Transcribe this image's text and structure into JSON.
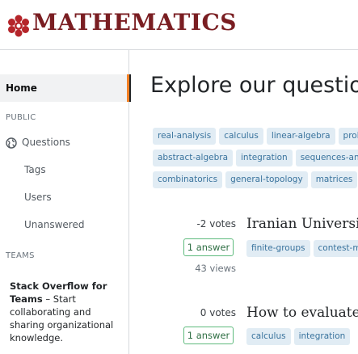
{
  "header": {
    "site_name": "MATHEMATICS",
    "logo_color": "#7a1e22"
  },
  "sidebar": {
    "home_label": "Home",
    "public_section": "PUBLIC",
    "items": [
      {
        "label": "Questions",
        "icon": "globe-icon"
      },
      {
        "label": "Tags"
      },
      {
        "label": "Users"
      },
      {
        "label": "Unanswered"
      }
    ],
    "teams_section": "TEAMS",
    "teams_title": "Stack Overflow for Teams",
    "teams_dash": " – Start",
    "teams_body": "collaborating and sharing organizational knowledge."
  },
  "main": {
    "title": "Explore our questions",
    "tag_rows": [
      [
        "real-analysis",
        "calculus",
        "linear-algebra",
        "probability"
      ],
      [
        "abstract-algebra",
        "integration",
        "sequences-and-series"
      ],
      [
        "combinatorics",
        "general-topology",
        "matrices"
      ]
    ],
    "questions": [
      {
        "votes": "-2 votes",
        "answers": "1 answer",
        "views": "43 views",
        "title": "Iranian University",
        "tags": [
          "finite-groups",
          "contest-math"
        ]
      },
      {
        "votes": "0 votes",
        "answers": "1 answer",
        "views": "",
        "title": "How to evaluate th",
        "tags": [
          "calculus",
          "integration"
        ]
      }
    ]
  },
  "colors": {
    "accent": "#f48024",
    "tag_bg": "#e1ecf4",
    "tag_text": "#39739d",
    "answer_border": "#5eba7d"
  }
}
